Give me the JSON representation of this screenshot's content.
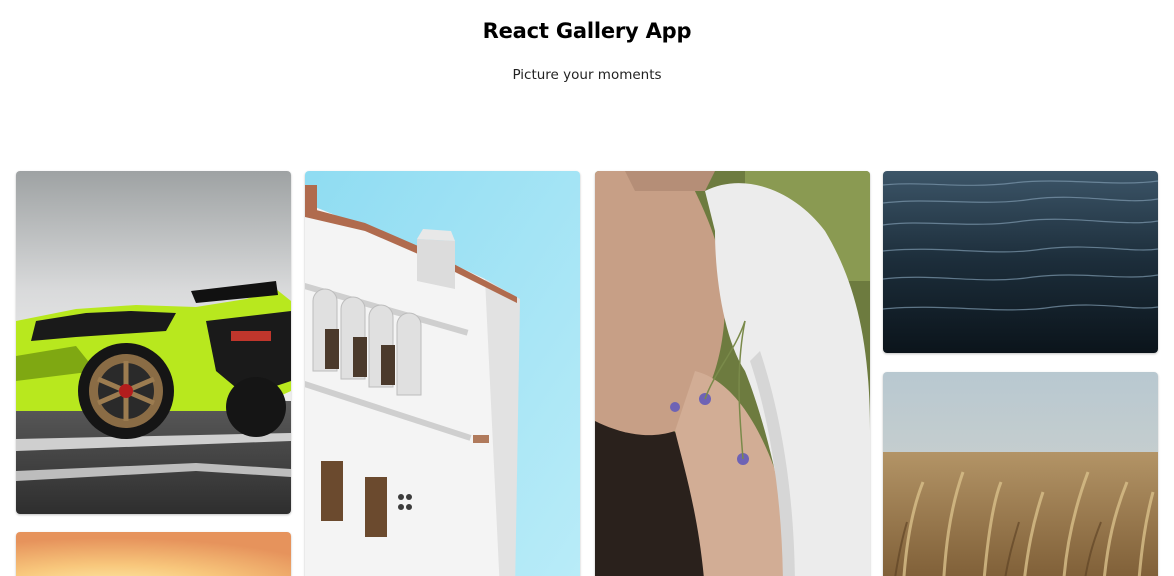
{
  "header": {
    "title": "React Gallery App",
    "subtitle": "Picture your moments"
  },
  "gallery": {
    "photos": [
      {
        "subject": "lime green sports car in parking lot"
      },
      {
        "subject": "orange gradient"
      },
      {
        "subject": "white building against blue sky"
      },
      {
        "subject": "woman lying in grass with flowers"
      },
      {
        "subject": "dark rippling water"
      },
      {
        "subject": "golden wheat field"
      }
    ]
  },
  "colors": {
    "background": "#ffffff",
    "title": "#000000",
    "subtitle": "#222222"
  }
}
